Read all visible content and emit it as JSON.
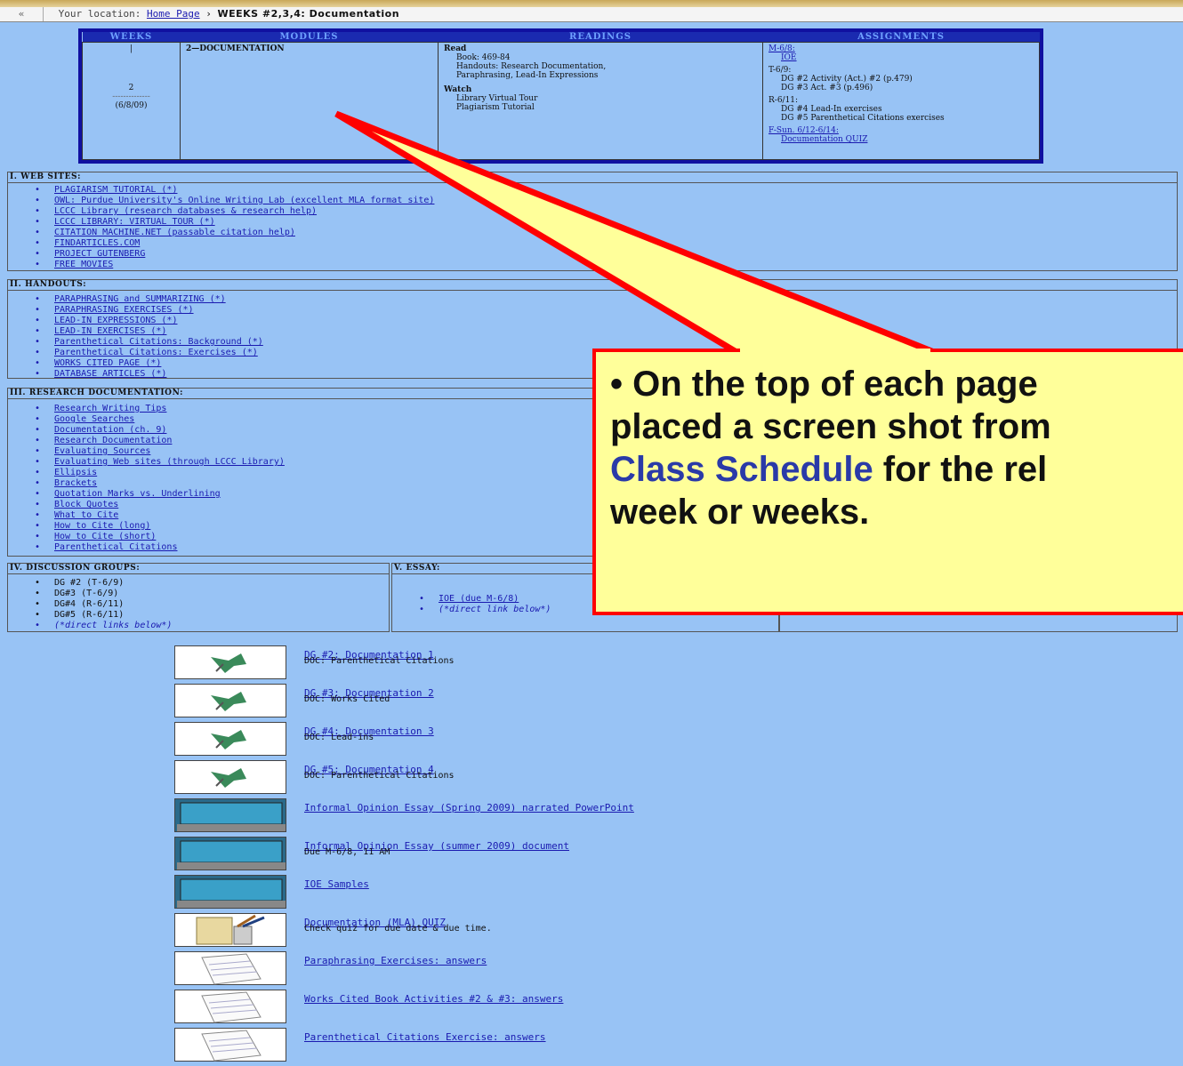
{
  "location": {
    "back": "«",
    "label": "Your location:",
    "home": "Home Page",
    "separator": "›",
    "current": "WEEKS #2,3,4: Documentation"
  },
  "schedule": {
    "headers": [
      "WEEKS",
      "MODULES",
      "READINGS",
      "ASSIGNMENTS"
    ],
    "week_num": "2",
    "week_top": "|",
    "week_dashes": "--------------",
    "week_date": "(6/8/09)",
    "module": "2—DOCUMENTATION",
    "read_label": "Read",
    "read_items": [
      "Book: 469-84",
      "Handouts: Research Documentation, Paraphrasing, Lead-In Expressions"
    ],
    "watch_label": "Watch",
    "watch_items": [
      "Library Virtual Tour",
      "Plagiarism Tutorial"
    ],
    "assign_m": "M-6/8:",
    "assign_m_item": "IOE",
    "assign_t": "T-6/9:",
    "assign_t_items": [
      "DG #2  Activity (Act.) #2 (p.479)",
      "DG #3  Act. #3 (p.496)"
    ],
    "assign_r": "R-6/11:",
    "assign_r_items": [
      "DG #4  Lead-In exercises",
      "DG #5  Parenthetical Citations exercises"
    ],
    "assign_f": "F-Sun. 6/12-6/14:",
    "assign_f_item": "Documentation QUIZ"
  },
  "web_sites": {
    "title": "I. WEB SITES:",
    "items": [
      "PLAGIARISM TUTORIAL (*)",
      "OWL: Purdue University's Online Writing Lab (excellent MLA format site)",
      "LCCC Library (research databases & research help)",
      "LCCC LIBRARY: VIRTUAL TOUR (*)",
      "CITATION MACHINE.NET (passable citation help)",
      "FINDARTICLES.COM",
      "PROJECT GUTENBERG",
      "FREE MOVIES"
    ]
  },
  "handouts": {
    "title": "II. HANDOUTS:",
    "items": [
      "PARAPHRASING and SUMMARIZING (*)",
      "PARAPHRASING EXERCISES (*)",
      "LEAD-IN EXPRESSIONS (*)",
      "LEAD-IN EXERCISES (*)",
      "Parenthetical Citations:  Background (*)",
      "Parenthetical Citations:  Exercises (*)",
      "WORKS CITED PAGE (*)",
      "DATABASE ARTICLES (*)"
    ]
  },
  "research": {
    "title": "III. RESEARCH DOCUMENTATION:",
    "items": [
      "Research Writing Tips",
      "Google Searches",
      "Documentation (ch. 9)",
      "Research Documentation",
      "Evaluating Sources",
      "Evaluating Web sites (through LCCC Library)",
      "Ellipsis",
      "Brackets",
      "Quotation Marks vs. Underlining",
      "Block Quotes",
      "What to Cite",
      "How to Cite (long)",
      "How to Cite (short)",
      "Parenthetical Citations"
    ]
  },
  "discussion": {
    "title": "IV. DISCUSSION GROUPS:",
    "items": [
      "DG #2 (T-6/9)",
      "DG#3 (T-6/9)",
      "DG#4 (R-6/11)",
      "DG#5 (R-6/11)"
    ],
    "note": "(*direct links below*)"
  },
  "essay": {
    "title": "V. ESSAY:",
    "items": [
      "IOE (due M-6/8)",
      "(*direct link below*)"
    ]
  },
  "resources": [
    {
      "icon": "pushpin-icon",
      "title": "DG #2: Documentation 1",
      "sub": "DOC: Parenthetical Citations"
    },
    {
      "icon": "pushpin-icon",
      "title": "DG #3: Documentation 2",
      "sub": "DOC: Works Cited"
    },
    {
      "icon": "pushpin-icon",
      "title": "DG #4: Documentation 3",
      "sub": "DOC: Lead-ins"
    },
    {
      "icon": "pushpin-icon",
      "title": "DG #5: Documentation 4",
      "sub": "DOC: Parenthetical Citations"
    },
    {
      "icon": "laptop-icon",
      "title": "Informal Opinion Essay (Spring 2009) narrated PowerPoint",
      "sub": ""
    },
    {
      "icon": "laptop-icon",
      "title": "Informal Opinion Essay (summer 2009) document",
      "sub": "Due M-6/8, 11 AM"
    },
    {
      "icon": "laptop-icon",
      "title": "IOE Samples",
      "sub": ""
    },
    {
      "icon": "quiz-icon",
      "title": "Documentation (MLA) QUIZ",
      "sub": "Check quiz for due date & due time."
    },
    {
      "icon": "notepad-icon",
      "title": "Paraphrasing Exercises: answers",
      "sub": ""
    },
    {
      "icon": "notepad-icon",
      "title": "Works Cited Book Activities #2 & #3: answers",
      "sub": ""
    },
    {
      "icon": "notepad-icon",
      "title": "Parenthetical Citations Exercise: answers",
      "sub": ""
    }
  ],
  "callout": {
    "line1": "• On the top of each page",
    "line2": "placed a screen shot from",
    "line3_blue": "Class Schedule",
    "line3_rest": " for the rel",
    "line4": "week or weeks."
  }
}
